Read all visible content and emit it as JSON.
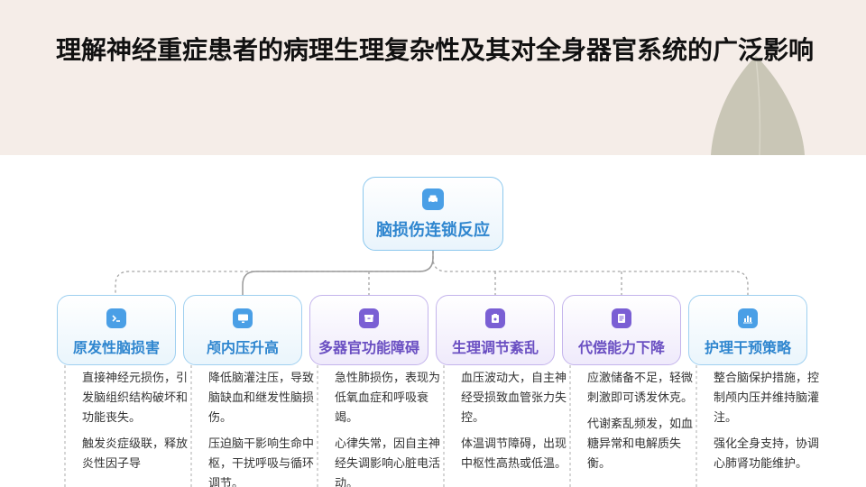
{
  "title": "理解神经重症患者的病理生理复杂性及其对全身器官系统的广泛影响",
  "root": {
    "label": "脑损伤连锁反应",
    "icon": "car-icon"
  },
  "nodes": [
    {
      "label": "原发性脑损害",
      "icon": "terminal-icon",
      "color": "#2f86cf",
      "items": [
        "直接神经元损伤，引发脑组织结构破坏和功能丧失。",
        "触发炎症级联，释放炎性因子导"
      ]
    },
    {
      "label": "颅内压升高",
      "icon": "monitor-icon",
      "color": "#2f86cf",
      "items": [
        "降低脑灌注压，导致脑缺血和继发性脑损伤。",
        "压迫脑干影响生命中枢，干扰呼吸与循环调节。"
      ]
    },
    {
      "label": "多器官功能障碍",
      "icon": "box-icon",
      "color": "#6a4fc2",
      "items": [
        "急性肺损伤，表现为低氧血症和呼吸衰竭。",
        "心律失常，因自主神经失调影响心脏电活动。"
      ]
    },
    {
      "label": "生理调节紊乱",
      "icon": "clipboard-icon",
      "color": "#6a4fc2",
      "items": [
        "血压波动大，自主神经受损致血管张力失控。",
        "体温调节障碍，出现中枢性高热或低温。"
      ]
    },
    {
      "label": "代偿能力下降",
      "icon": "document-icon",
      "color": "#6a4fc2",
      "items": [
        "应激储备不足，轻微刺激即可诱发休克。",
        "代谢紊乱频发，如血糖异常和电解质失衡。"
      ]
    },
    {
      "label": "护理干预策略",
      "icon": "bar-chart-icon",
      "color": "#2f86cf",
      "items": [
        "整合脑保护措施，控制颅内压并维持脑灌注。",
        "强化全身支持，协调心肺肾功能维护。"
      ]
    }
  ]
}
